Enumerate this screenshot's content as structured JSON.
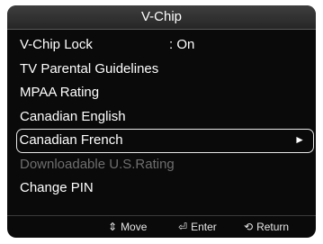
{
  "window": {
    "title": "V-Chip"
  },
  "menu": {
    "items": [
      {
        "label": "V-Chip Lock",
        "value": ": On"
      },
      {
        "label": "TV Parental Guidelines"
      },
      {
        "label": "MPAA Rating"
      },
      {
        "label": "Canadian English"
      },
      {
        "label": "Canadian French",
        "arrow": "►"
      },
      {
        "label": "Downloadable U.S.Rating"
      },
      {
        "label": "Change PIN"
      }
    ]
  },
  "footer": {
    "move": {
      "icon": "⇕",
      "label": "Move"
    },
    "enter": {
      "icon": "⏎",
      "label": "Enter"
    },
    "return": {
      "icon": "⟲",
      "label": "Return"
    }
  }
}
